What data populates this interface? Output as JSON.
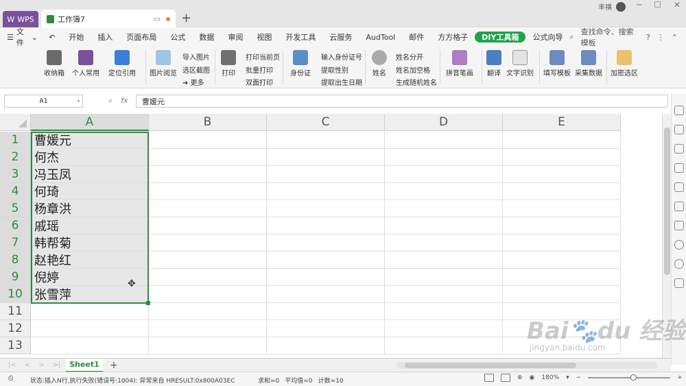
{
  "titlebar": {
    "app_tab": "WPS",
    "doc_tab": "工作簿7",
    "user_name": "丰祺"
  },
  "menu": {
    "file": "文件",
    "items": [
      "开始",
      "插入",
      "页面布局",
      "公式",
      "数据",
      "审阅",
      "视图",
      "开发工具",
      "云服务",
      "AudTool",
      "邮件",
      "方方格子",
      "DIY工具箱",
      "公式向导"
    ],
    "search": "查找命令、搜索模板",
    "accent": "#1fa24a"
  },
  "toolbar": {
    "collect": "收纳箱",
    "personal": "个人常用",
    "locate_ref": "定位引用",
    "image_browse": "图片阅览",
    "import_image": "导入图片",
    "area_capture": "选区截图",
    "more": "更多",
    "print": "打印",
    "print_current": "打印当前页",
    "batch_print": "批量打印",
    "duplex_print": "双面打印",
    "id_card": "身份证",
    "input_id": "输入身份证号",
    "extract_gender": "提取性别",
    "extract_birth": "提取出生日期",
    "name": "姓名",
    "split_name": "姓名分开",
    "name_space": "姓名加空格",
    "random_name": "生成随机姓名",
    "pinyin": "拼音笔画",
    "translate": "翻译",
    "ocr": "文字识别",
    "fill_template": "填写模板",
    "collect_data": "采集数据",
    "encrypt": "加密选区"
  },
  "formula_bar": {
    "name_box": "A1",
    "fx": "fx",
    "value": "曹媛元"
  },
  "sheet": {
    "columns": [
      "A",
      "B",
      "C",
      "D",
      "E"
    ],
    "rows": [
      "1",
      "2",
      "3",
      "4",
      "5",
      "6",
      "7",
      "8",
      "9",
      "10",
      "11",
      "12",
      "13"
    ],
    "col_a": [
      "曹媛元",
      "何杰",
      "冯玉凤",
      "何琦",
      "杨章洪",
      "戚瑶",
      "韩帮菊",
      "赵艳红",
      "倪婷",
      "张雪萍",
      "",
      "",
      ""
    ],
    "selection_color": "#2e8b3d"
  },
  "sheet_tabs": {
    "active": "Sheet1",
    "add": "+"
  },
  "status": {
    "message": "状态:插入N行,执行失败(错误号:1004): 异常来自 HRESULT:0x800A03EC",
    "sum": "求和=0",
    "avg": "平均值=0",
    "count": "计数=10",
    "zoom": "180%"
  },
  "watermark": {
    "logo": "Bai du 经验",
    "url": "jingyan.baidu.com"
  }
}
